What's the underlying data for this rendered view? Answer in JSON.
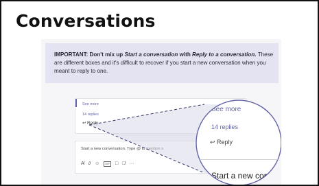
{
  "heading": "Conversations",
  "banner": {
    "prefix": "IMPORTANT: Don't mix up ",
    "start_term": "Start a conversation",
    "middle": " with ",
    "reply_term": "Reply to a conversation.",
    "body": "These are different boxes and it's difficult to recover if you start a new conversation when you meant to reply to one."
  },
  "thread": {
    "see_more": "See more",
    "replies": "14 replies",
    "reply_label": "↩ Reply"
  },
  "composer": {
    "placeholder": "Start a new conversation. Type @ to mention s",
    "tools": [
      "A̸",
      "∂",
      "☺",
      "GIF",
      "□",
      "□̸",
      "···"
    ]
  },
  "zoom": {
    "see_more": "See more",
    "replies": "14 replies",
    "reply_label": "↩ Reply",
    "start_text": "Start a new cor"
  },
  "colors": {
    "accent": "#6264a7",
    "banner_bg": "#e4e3f1",
    "zoom_fill": "#d9d8ea"
  }
}
